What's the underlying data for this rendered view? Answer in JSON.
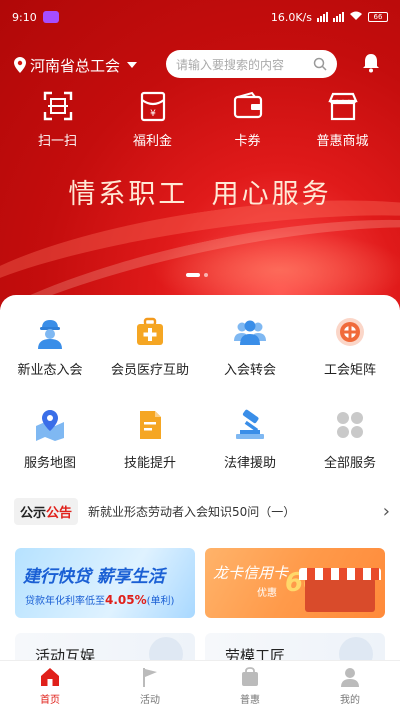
{
  "status": {
    "time": "9:10",
    "network_speed": "16.0K/s",
    "battery": "66"
  },
  "header": {
    "location": "河南省总工会",
    "search_placeholder": "请输入要搜索的内容"
  },
  "quick_actions": [
    {
      "label": "扫一扫",
      "icon": "scan-icon"
    },
    {
      "label": "福利金",
      "icon": "red-envelope-icon"
    },
    {
      "label": "卡券",
      "icon": "wallet-icon"
    },
    {
      "label": "普惠商城",
      "icon": "store-icon"
    }
  ],
  "banner": {
    "slogan": "情系职工  用心服务"
  },
  "services": [
    {
      "label": "新业态入会",
      "icon": "worker-icon"
    },
    {
      "label": "会员医疗互助",
      "icon": "medical-kit-icon"
    },
    {
      "label": "入会转会",
      "icon": "people-group-icon"
    },
    {
      "label": "工会矩阵",
      "icon": "union-emblem-icon"
    },
    {
      "label": "服务地图",
      "icon": "map-pin-icon"
    },
    {
      "label": "技能提升",
      "icon": "document-icon"
    },
    {
      "label": "法律援助",
      "icon": "gavel-icon"
    },
    {
      "label": "全部服务",
      "icon": "grid-icon"
    }
  ],
  "notice": {
    "tag_part1": "公示",
    "tag_part2": "公告",
    "text": "新就业形态劳动者入会知识50问（一）"
  },
  "promos": {
    "left_title": "建行快贷  薪享生活",
    "left_sub_prefix": "贷款年化利率低至",
    "left_rate": "4.05%",
    "left_sub_suffix": "(单利)",
    "right_title": "龙卡信用卡",
    "right_number": "666",
    "right_sub": "优惠"
  },
  "cards": [
    {
      "label": "活动互娱"
    },
    {
      "label": "劳模工匠"
    }
  ],
  "tabs": [
    {
      "label": "首页",
      "icon": "home-icon",
      "active": true
    },
    {
      "label": "活动",
      "icon": "flag-icon",
      "active": false
    },
    {
      "label": "普惠",
      "icon": "shopping-bag-icon",
      "active": false
    },
    {
      "label": "我的",
      "icon": "user-icon",
      "active": false
    }
  ],
  "colors": {
    "brand_red": "#e0201a",
    "banner_red": "#c40d0d"
  }
}
